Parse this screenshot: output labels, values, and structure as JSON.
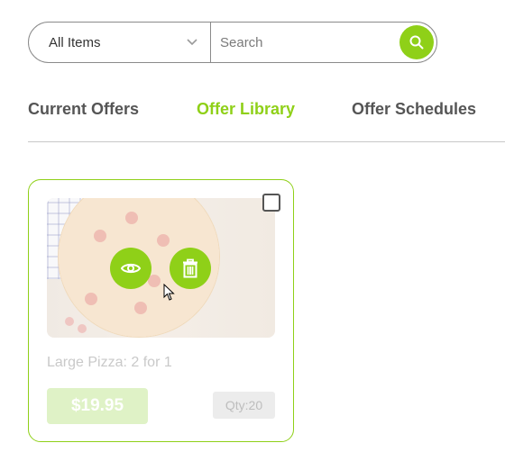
{
  "search": {
    "category_value": "All Items",
    "placeholder": "Search",
    "value": ""
  },
  "tabs": [
    {
      "label": "Current Offers",
      "active": false
    },
    {
      "label": "Offer Library",
      "active": true
    },
    {
      "label": "Offer Schedules",
      "active": false
    }
  ],
  "offer_card": {
    "title": "Large Pizza: 2 for 1",
    "price": "$19.95",
    "qty": "Qty:20",
    "checked": false
  },
  "icons": {
    "category_chevron": "chevron-down-icon",
    "search_button": "search-icon",
    "view_button": "eye-icon",
    "delete_button": "trash-icon"
  },
  "colors": {
    "accent": "#8fd018",
    "tab_inactive": "#555555",
    "price_bg": "#dff2c6"
  }
}
